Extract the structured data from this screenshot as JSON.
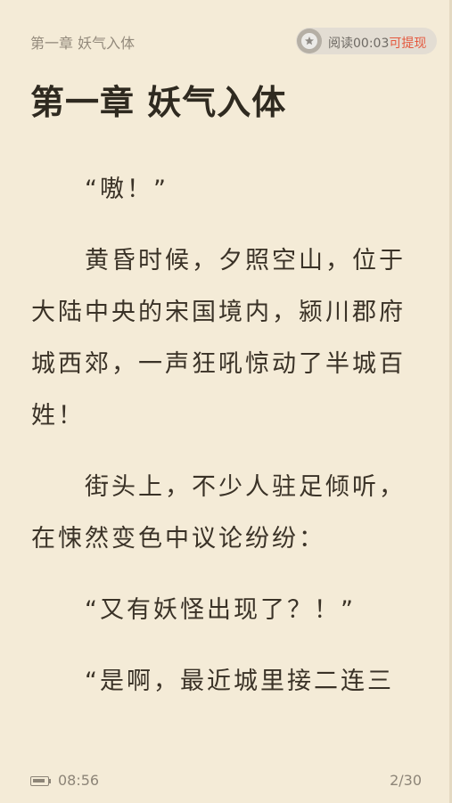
{
  "header": {
    "chapter": "第一章 妖气入体",
    "reward_prefix": "阅读",
    "reward_timer": "00:03",
    "reward_link": "可提现",
    "reward_icon": "star-badge-icon"
  },
  "chapter": {
    "title": "第一章 妖气入体",
    "paragraphs": [
      "“嗷！”",
      "黄昏时候，夕照空山，位于大陆中央的宋国境内，颍川郡府城西郊，一声狂吼惊动了半城百姓！",
      "街头上，不少人驻足倾听，在悚然变色中议论纷纷：",
      "“又有妖怪出现了？！”",
      "“是啊，最近城里接二连三"
    ]
  },
  "footer": {
    "time": "08:56",
    "page": "2/30",
    "battery_icon": "battery-icon",
    "battery_level": 0.9
  },
  "colors": {
    "background": "#f4ebd7",
    "text": "#3a3227",
    "accent": "#e4593f"
  }
}
